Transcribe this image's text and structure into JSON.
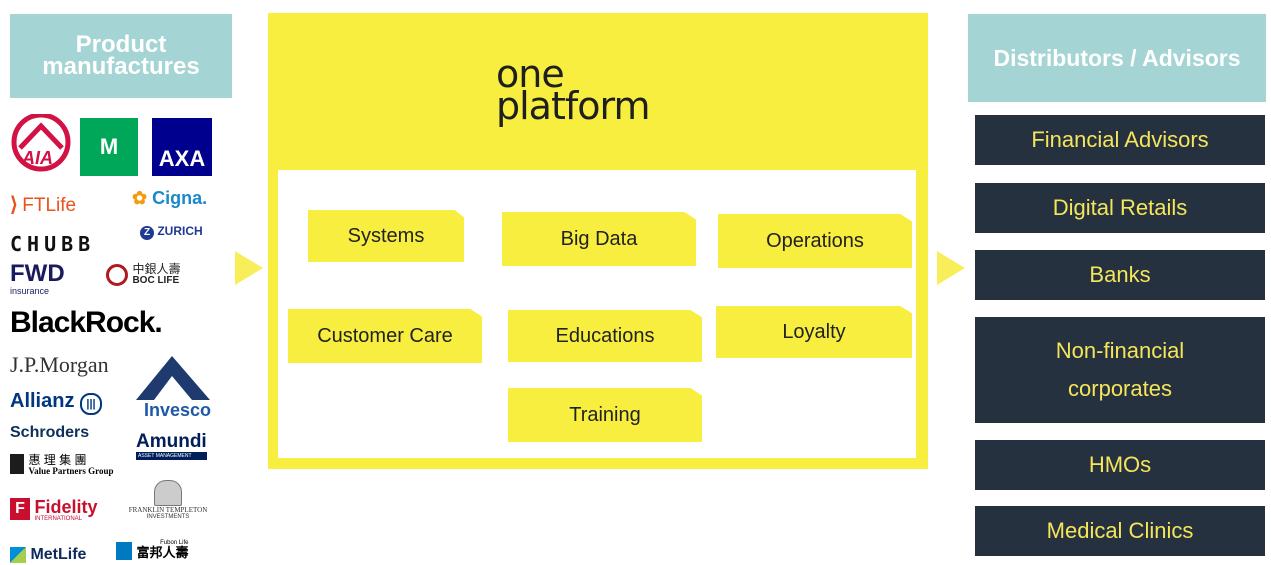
{
  "left_header": {
    "line1": "Product",
    "line2": "manufactures"
  },
  "right_header": {
    "title": "Distributors / Advisors"
  },
  "logos": {
    "aia": "AIA",
    "manulife": "M",
    "axa": "AXA",
    "ftlife": "FTLife",
    "cigna": "Cigna.",
    "chubb": "CHUBB",
    "zurich": "ZURICH",
    "fwd": "FWD",
    "fwd_sub": "insurance",
    "boc_cn": "中銀人壽",
    "boc_en": "BOC LIFE",
    "blackrock": "BlackRock.",
    "jpmorgan": "J.P.Morgan",
    "allianz": "Allianz",
    "invesco": "Invesco",
    "schroders": "Schroders",
    "amundi": "Amundi",
    "amundi_sub": "ASSET MANAGEMENT",
    "vp_cn": "惠 理 集 團",
    "vp_en": "Value Partners Group",
    "fidelity": "Fidelity",
    "fidelity_sub": "INTERNATIONAL",
    "franklin": "FRANKLIN TEMPLETON",
    "franklin_sub": "INVESTMENTS",
    "metlife": "MetLife",
    "fubon_cn": "富邦人壽",
    "fubon_en": "Fubon Life"
  },
  "platform": {
    "brand_line1": "one",
    "brand_line2": "platform",
    "modules": [
      "Systems",
      "Big Data",
      "Operations",
      "Customer Care",
      "Educations",
      "Loyalty",
      "Training"
    ]
  },
  "distributors": [
    "Financial Advisors",
    "Digital Retails",
    "Banks",
    "Non-financial corporates",
    "HMOs",
    "Medical Clinics"
  ],
  "colors": {
    "header_bg": "#a4d4d3",
    "platform_yellow": "#f8ee40",
    "arrow_yellow": "#f8ee5a",
    "distributor_bg": "#263140",
    "distributor_text": "#f4e55a"
  }
}
